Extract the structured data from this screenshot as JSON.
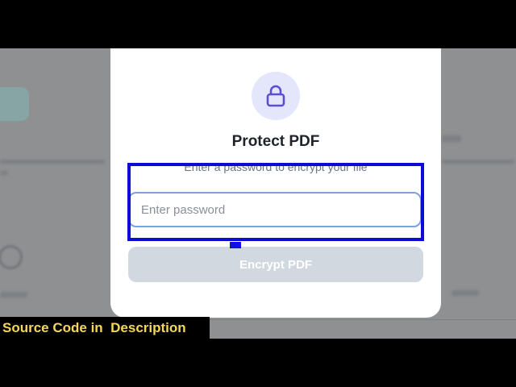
{
  "modal": {
    "icon": "lock-icon",
    "title": "Protect PDF",
    "subtitle": "Enter a password to encrypt your file",
    "password_placeholder": "Enter password",
    "password_value": "",
    "encrypt_button_label": "Encrypt PDF"
  },
  "caption": {
    "text": "Source Code in  Description"
  },
  "colors": {
    "accent": "#5b4fcf",
    "icon_bg": "#e4e6fb",
    "input_border": "#7aa1e0",
    "button_disabled": "#d1d8e0",
    "annotation": "#0d0ad6",
    "caption_text": "#f6d75a"
  }
}
